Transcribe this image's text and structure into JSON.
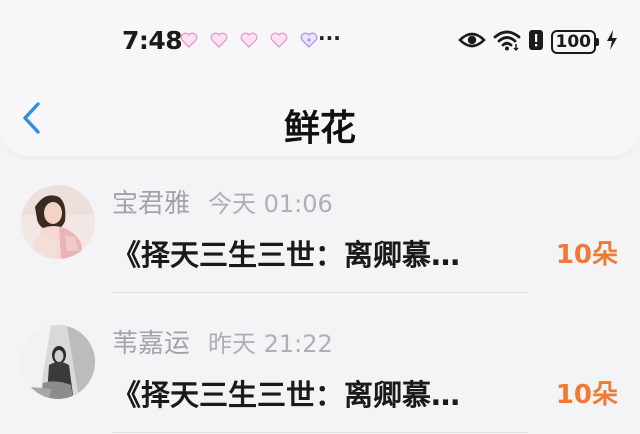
{
  "status_bar": {
    "time": "7:48",
    "more_indicator": "···",
    "battery_level": "100",
    "icons": [
      "heart-notification-icon",
      "heart-notification-icon",
      "heart-notification-icon",
      "heart-notification-icon",
      "heart-notification-icon",
      "eye-icon",
      "wifi-icon",
      "alert-icon",
      "battery-icon",
      "charging-icon"
    ]
  },
  "nav": {
    "title": "鲜花",
    "back_icon": "chevron-left-icon"
  },
  "colors": {
    "back_accent": "#2f8fe0",
    "amount_accent": "#f07a35"
  },
  "gift_list": [
    {
      "sender": "宝君雅",
      "time": "今天 01:06",
      "title": "《择天三生三世：离卿慕…",
      "amount": "10朵"
    },
    {
      "sender": "苇嘉运",
      "time": "昨天 21:22",
      "title": "《择天三生三世：离卿慕…",
      "amount": "10朵"
    }
  ]
}
